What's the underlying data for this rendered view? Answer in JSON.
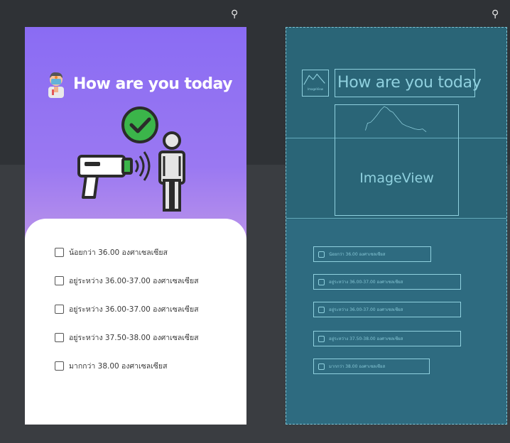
{
  "design": {
    "title": "How are you today",
    "options": [
      "น้อยกว่า 36.00 องศาเซลเซียส",
      "อยู่ระหว่าง 36.00-37.00 องศาเซลเซียส",
      "อยู่ระหว่าง 36.00-37.00 องศาเซลเซียส",
      "อยู่ระหว่าง 37.50-38.00 องศาเซลเซียส",
      "มากกว่า 38.00 องศาเซลเซียส"
    ]
  },
  "blueprint": {
    "title": "How are you today",
    "image_view_label": "ImageView",
    "thumb_label": "ImageView",
    "options": [
      "น้อยกว่า 36.00 องศาเซลเซียส",
      "อยู่ระหว่าง 36.00-37.00 องศาเซลเซียส",
      "อยู่ระหว่าง 36.00-37.00 องศาเซลเซียส",
      "อยู่ระหว่าง 37.50-38.00 องศาเซลเซียส",
      "มากกว่า 38.00 องศาเซลเซียส"
    ]
  },
  "icons": {
    "pin_left": "pin-icon",
    "pin_right": "pin-icon",
    "doctor": "doctor-avatar-icon",
    "hero": "thermometer-gun-check-illustration"
  },
  "colors": {
    "editor_bg": "#2f3236",
    "gradient_top": "#8a6cf3",
    "gradient_bottom": "#d6b3e6",
    "blueprint_bg": "#2e6b80",
    "blueprint_line": "#8fd0de",
    "check_green": "#3bb54a"
  }
}
